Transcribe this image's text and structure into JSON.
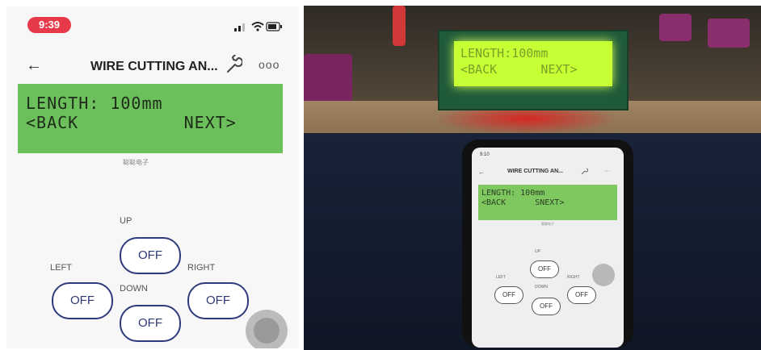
{
  "app": {
    "status_time": "9:39",
    "title": "WIRE CUTTING AN...",
    "more_label": "ooo",
    "back_glyph": "←"
  },
  "lcd": {
    "line1": "LENGTH: 100mm",
    "line2": "<BACK          NEXT>",
    "brand": "聪聪电子",
    "color": "#6cc05b"
  },
  "controls": {
    "up_label": "UP",
    "down_label": "DOWN",
    "left_label": "LEFT",
    "right_label": "RIGHT",
    "up_button": "OFF",
    "down_button": "OFF",
    "left_button": "OFF",
    "right_button": "OFF"
  },
  "photo": {
    "lcd_line1": "LENGTH:100mm",
    "lcd_line2": "<BACK      NEXT>",
    "phone_time": "9:10",
    "phone_title": "WIRE CUTTING AN...",
    "phone_lcd_line1": "LENGTH: 100mm",
    "phone_lcd_line2": "<BACK      SNEXT>",
    "phone_brand": "聪聪电子",
    "up_label": "UP",
    "down_label": "DOWN",
    "left_label": "LEFT",
    "right_label": "RIGHT",
    "up_button": "OFF",
    "down_button": "OFF",
    "left_button": "OFF",
    "right_button": "OFF"
  },
  "icons": {
    "back": "back-arrow-icon",
    "settings": "wrench-icon",
    "more": "more-icon",
    "joystick": "joystick-icon",
    "signal": "signal-icon",
    "wifi": "wifi-icon",
    "battery": "battery-icon"
  }
}
